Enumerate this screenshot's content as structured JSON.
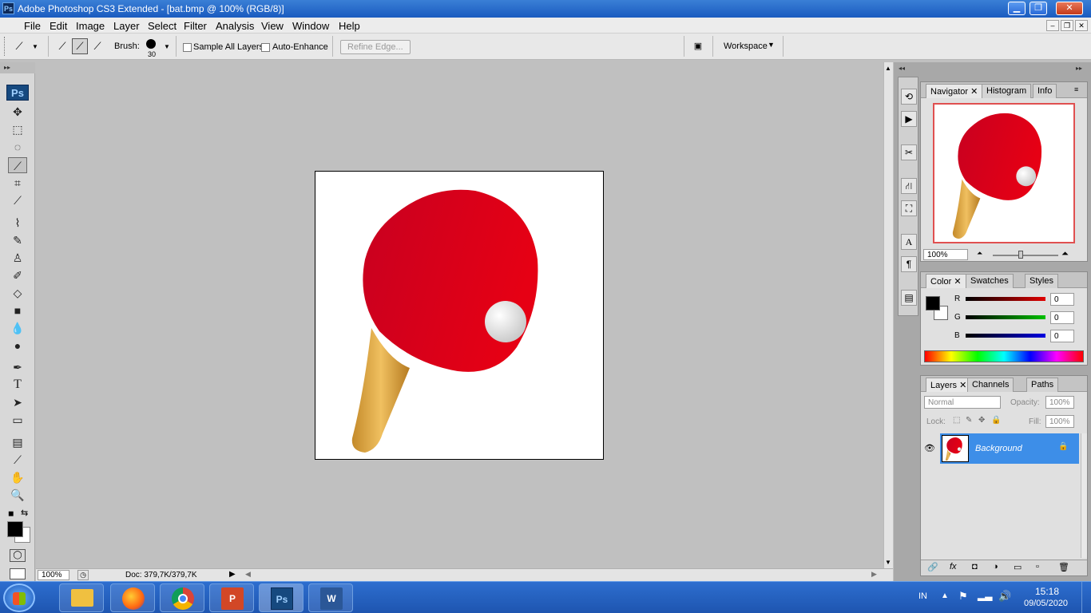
{
  "window": {
    "app_icon": "Ps",
    "title": "Adobe Photoshop CS3 Extended - [bat.bmp @ 100% (RGB/8)]",
    "controls": [
      "minimize",
      "restore",
      "close"
    ]
  },
  "menu": [
    "File",
    "Edit",
    "Image",
    "Layer",
    "Select",
    "Filter",
    "Analysis",
    "View",
    "Window",
    "Help"
  ],
  "options": {
    "brush_label": "Brush:",
    "brush_size": "30",
    "sample_all_layers": "Sample All Layers",
    "auto_enhance": "Auto-Enhance",
    "refine_edge": "Refine Edge...",
    "workspace": "Workspace"
  },
  "toolbox": {
    "logo": "Ps",
    "type_tool_glyph": "T"
  },
  "document": {
    "filename": "bat.bmp",
    "zoom": "100%",
    "doc_info": "Doc: 379,7K/379,7K"
  },
  "navigator": {
    "tabs": [
      "Navigator",
      "Histogram",
      "Info"
    ],
    "zoom": "100%"
  },
  "color": {
    "tabs": [
      "Color",
      "Swatches",
      "Styles"
    ],
    "channels": [
      {
        "label": "R",
        "value": "0",
        "color": "#e00000"
      },
      {
        "label": "G",
        "value": "0",
        "color": "#00b000"
      },
      {
        "label": "B",
        "value": "0",
        "color": "#0000e0"
      }
    ]
  },
  "layers": {
    "tabs": [
      "Layers",
      "Channels",
      "Paths"
    ],
    "blend_mode": "Normal",
    "opacity_label": "Opacity:",
    "opacity_value": "100%",
    "lock_label": "Lock:",
    "fill_label": "Fill:",
    "fill_value": "100%",
    "items": [
      {
        "name": "Background"
      }
    ]
  },
  "taskbar": {
    "language": "IN",
    "time": "15:18",
    "date": "09/05/2020",
    "apps": [
      "file-explorer",
      "firefox",
      "chrome",
      "powerpoint",
      "photoshop",
      "word"
    ],
    "word_glyph": "W",
    "ppt_glyph": "P"
  },
  "colors": {
    "paddle_red": "#d3001f",
    "handle_gold": "#d9a24a",
    "selection_blue": "#3d8ee8",
    "taskbar_blue": "#1e55b0"
  }
}
